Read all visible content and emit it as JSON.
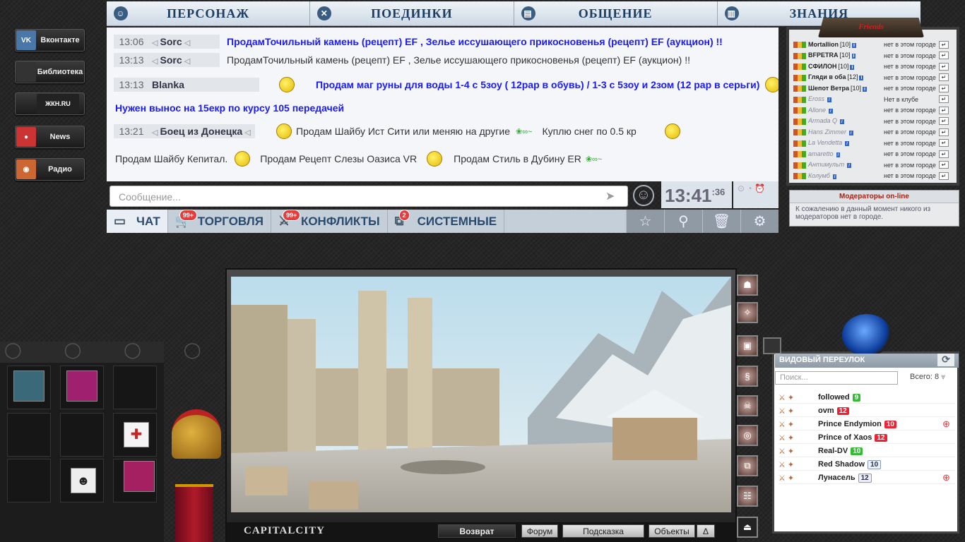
{
  "social": [
    {
      "label": "Вконтакте",
      "icon": "vk-icon",
      "icon_text": "VK",
      "color": "#4a76a8"
    },
    {
      "label": "Библиотека",
      "icon": "book-icon",
      "icon_text": "",
      "color": "#333"
    },
    {
      "label": "",
      "icon": "site-logo-icon",
      "icon_text": "ЖКН.RU",
      "color": "#222"
    },
    {
      "label": "News",
      "icon": "news-icon",
      "icon_text": "●",
      "color": "#c33"
    },
    {
      "label": "Радио",
      "icon": "radio-icon",
      "icon_text": "◉",
      "color": "#c63"
    }
  ],
  "nav": [
    {
      "label": "ПЕРСОНАЖ",
      "icon": "person-icon"
    },
    {
      "label": "ПОЕДИНКИ",
      "icon": "swords-icon"
    },
    {
      "label": "ОБЩЕНИЕ",
      "icon": "chat-icon"
    },
    {
      "label": "ЗНАНИЯ",
      "icon": "book-icon"
    }
  ],
  "chat": {
    "messages": [
      {
        "time": "13:06",
        "nick": "Sorc",
        "text": "ПродамТочильный камень (рецепт) EF , Зелье иссушающего прикосновенья (рецепт) EF (аукцион) !!"
      },
      {
        "time": "13:13",
        "nick": "Sorc",
        "text": "ПродамТочильный камень (рецепт) EF , Зелье иссушающего прикосновенья (рецепт) EF (аукцион) !!"
      },
      {
        "time": "13:13",
        "nick": "Blanka",
        "text": "Продам маг руны для воды 1-4 с 5зоу ( 12рар в обувь) / 1-3 с 5зоу и 2зом (12 рар в серьги)"
      },
      {
        "time": "",
        "nick": "",
        "text": "Нужен вынос на 15екр по курсу 105 передачей"
      },
      {
        "time": "13:21",
        "nick": "Боец из Донецка",
        "text": "Продам Шайбу Ист Сити или меняю на другие",
        "text2": "Куплю снег по 0.5 кр"
      },
      {
        "time": "",
        "nick": "",
        "text": "Продам Шайбу Кепитал.",
        "text2": "Продам Рецепт Слезы Оазиса VR",
        "text3": "Продам Стиль в Дубину ER"
      }
    ],
    "input_placeholder": "Сообщение...",
    "clock": "13:41",
    "clock_sec": ":36",
    "tabs": [
      {
        "label": "ЧАТ",
        "icon": "chat-icon",
        "badge": ""
      },
      {
        "label": "ТОРГОВЛЯ",
        "icon": "cart-icon",
        "badge": "99+"
      },
      {
        "label": "КОНФЛИКТЫ",
        "icon": "swords-icon",
        "badge": "99+"
      },
      {
        "label": "СИСТЕМНЫЕ",
        "icon": "network-icon",
        "badge": "2"
      }
    ]
  },
  "friends": {
    "title": "Friends",
    "list": [
      {
        "name": "Mortallion",
        "level": "[10]",
        "loc": "нет в этом городе",
        "online": true
      },
      {
        "name": "BFPETRA",
        "level": "[10]",
        "loc": "нет в этом городе",
        "online": true
      },
      {
        "name": "СФИЛОН",
        "level": "[10]",
        "loc": "нет в этом городе",
        "online": true
      },
      {
        "name": "Гляди в оба",
        "level": "[12]",
        "loc": "нет в этом городе",
        "online": true
      },
      {
        "name": "Шепот Ветра",
        "level": "[10]",
        "loc": "нет в этом городе",
        "online": true
      },
      {
        "name": "Eross",
        "level": "",
        "loc": "Нет в клубе",
        "online": false
      },
      {
        "name": "Allone",
        "level": "",
        "loc": "нет в этом городе",
        "online": false
      },
      {
        "name": "Armada Q",
        "level": "",
        "loc": "нет в этом городе",
        "online": false
      },
      {
        "name": "Hans Zimmer",
        "level": "",
        "loc": "нет в этом городе",
        "online": false
      },
      {
        "name": "La Vendetta",
        "level": "",
        "loc": "нет в этом городе",
        "online": false
      },
      {
        "name": "amaretto",
        "level": "",
        "loc": "нет в этом городе",
        "online": false
      },
      {
        "name": "Антимульт",
        "level": "",
        "loc": "нет в этом городе",
        "online": false
      },
      {
        "name": "Колумб",
        "level": "",
        "loc": "нет в этом городе",
        "online": false
      }
    ]
  },
  "moderators": {
    "title": "Модераторы on-line",
    "text": "К сожалению в данный момент никого из модераторов нет в городе."
  },
  "game": {
    "title": "CAPITALCITY",
    "buttons": [
      "Возврат",
      "Форум",
      "Подсказка",
      "Объекты",
      "Δ"
    ]
  },
  "location": {
    "title": "ВИДОВЫЙ ПЕРЕУЛОК",
    "search_placeholder": "Поиск...",
    "total_label": "Всего: 8",
    "players": [
      {
        "name": "followed",
        "level": "9",
        "color": "g",
        "target": false
      },
      {
        "name": "ovm",
        "level": "12",
        "color": "r",
        "target": false
      },
      {
        "name": "Prince Endymion",
        "level": "10",
        "color": "r",
        "target": true
      },
      {
        "name": "Prince of Xaos",
        "level": "12",
        "color": "r",
        "target": false
      },
      {
        "name": "Real-DV",
        "level": "10",
        "color": "g",
        "target": false
      },
      {
        "name": "Red Shadow",
        "level": "10",
        "color": "w",
        "target": false
      },
      {
        "name": "Лунасель",
        "level": "12",
        "color": "w",
        "target": true
      }
    ]
  }
}
